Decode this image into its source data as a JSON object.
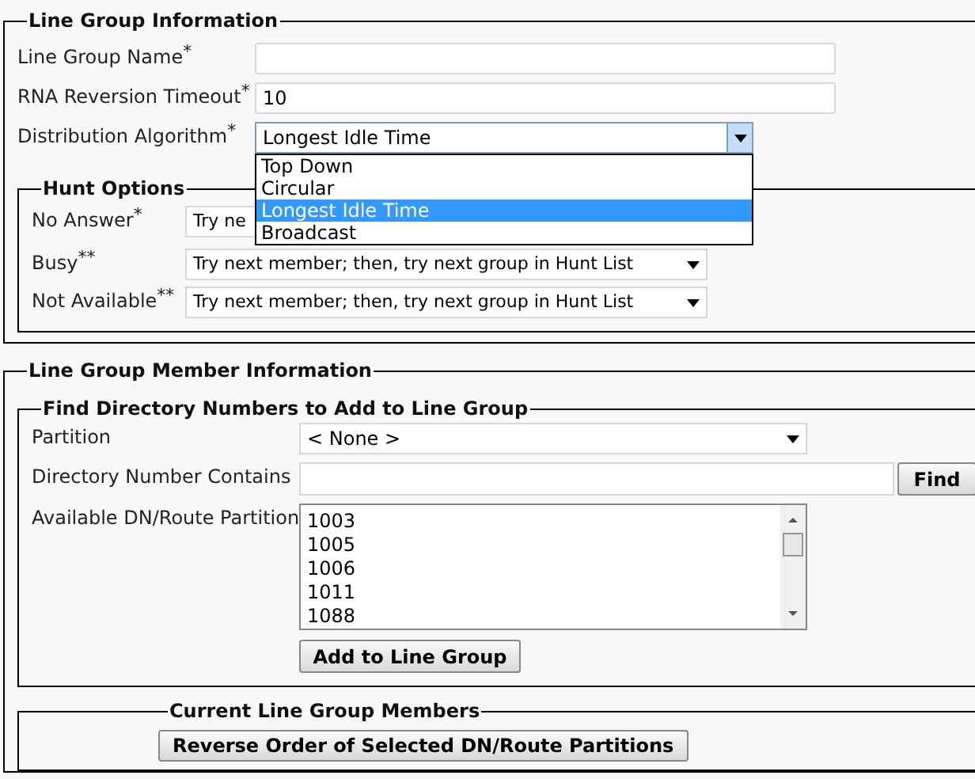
{
  "line_group_information": {
    "title": "Line Group Information",
    "fields": [
      {
        "kind": "text",
        "label": "Line Group Name",
        "required_mark": "*"
      },
      {
        "kind": "text",
        "label": "RNA Reversion Timeout",
        "required_mark": "*",
        "value": "10"
      },
      {
        "kind": "select",
        "label": "Distribution Algorithm",
        "required_mark": "*",
        "value": "Longest Idle Time",
        "expanded": true,
        "options": [
          {
            "label": "Top Down",
            "selected": false
          },
          {
            "label": "Circular",
            "selected": false
          },
          {
            "label": "Longest Idle Time",
            "selected": true
          },
          {
            "label": "Broadcast",
            "selected": false
          }
        ]
      }
    ],
    "hunt_options": {
      "title": "Hunt Options",
      "rows": [
        {
          "label": "No Answer",
          "required_mark": "*",
          "value": "Try ne"
        },
        {
          "label": "Busy",
          "required_mark": "**",
          "value": "Try next member; then, try next group in Hunt List"
        },
        {
          "label": "Not Available",
          "required_mark": "**",
          "value": "Try next member; then, try next group in Hunt List"
        }
      ]
    }
  },
  "line_group_member_information": {
    "title": "Line Group Member Information",
    "find_directory_numbers": {
      "title": "Find Directory Numbers to Add to Line Group",
      "partition": {
        "label": "Partition",
        "value": "< None >"
      },
      "directory_number_contains": {
        "label": "Directory Number Contains",
        "button": "Find"
      },
      "available_dn": {
        "label": "Available DN/Route Partition",
        "items": [
          "1003",
          "1005",
          "1006",
          "1011",
          "1088"
        ]
      },
      "add_button": "Add to Line Group"
    },
    "current_members": {
      "title": "Current Line Group Members",
      "button": "Reverse Order of Selected DN/Route Partitions"
    }
  }
}
